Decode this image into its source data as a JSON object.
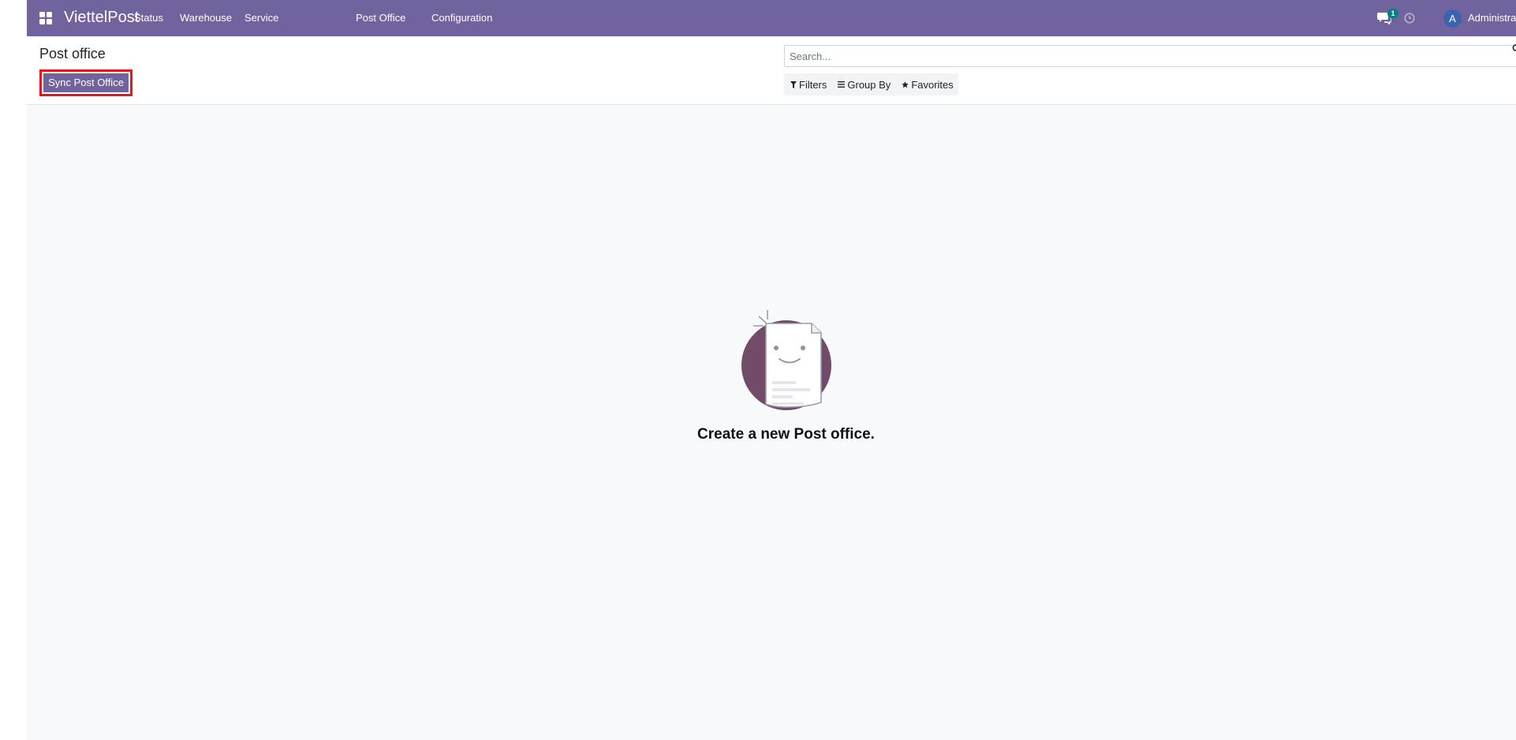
{
  "navbar": {
    "brand": "ViettelPost",
    "menu": [
      {
        "label": "Status"
      },
      {
        "label": "Warehouse"
      },
      {
        "label": "Service"
      },
      {
        "label": "Post Office"
      },
      {
        "label": "Configuration"
      }
    ],
    "chat_count": "1",
    "user_initial": "A",
    "user_name": "Administrator",
    "color": "#71639e"
  },
  "control_panel": {
    "title": "Post office",
    "sync_button": "Sync Post Office",
    "search_placeholder": "Search...",
    "filters": "Filters",
    "group_by": "Group By",
    "favorites": "Favorites"
  },
  "empty_state": {
    "message": "Create a new Post office."
  },
  "colors": {
    "primary": "#71639e",
    "highlight_border": "#e3191f",
    "badge": "#017e84",
    "avatar": "#3c63b0",
    "illustration_circle": "#714b67"
  }
}
